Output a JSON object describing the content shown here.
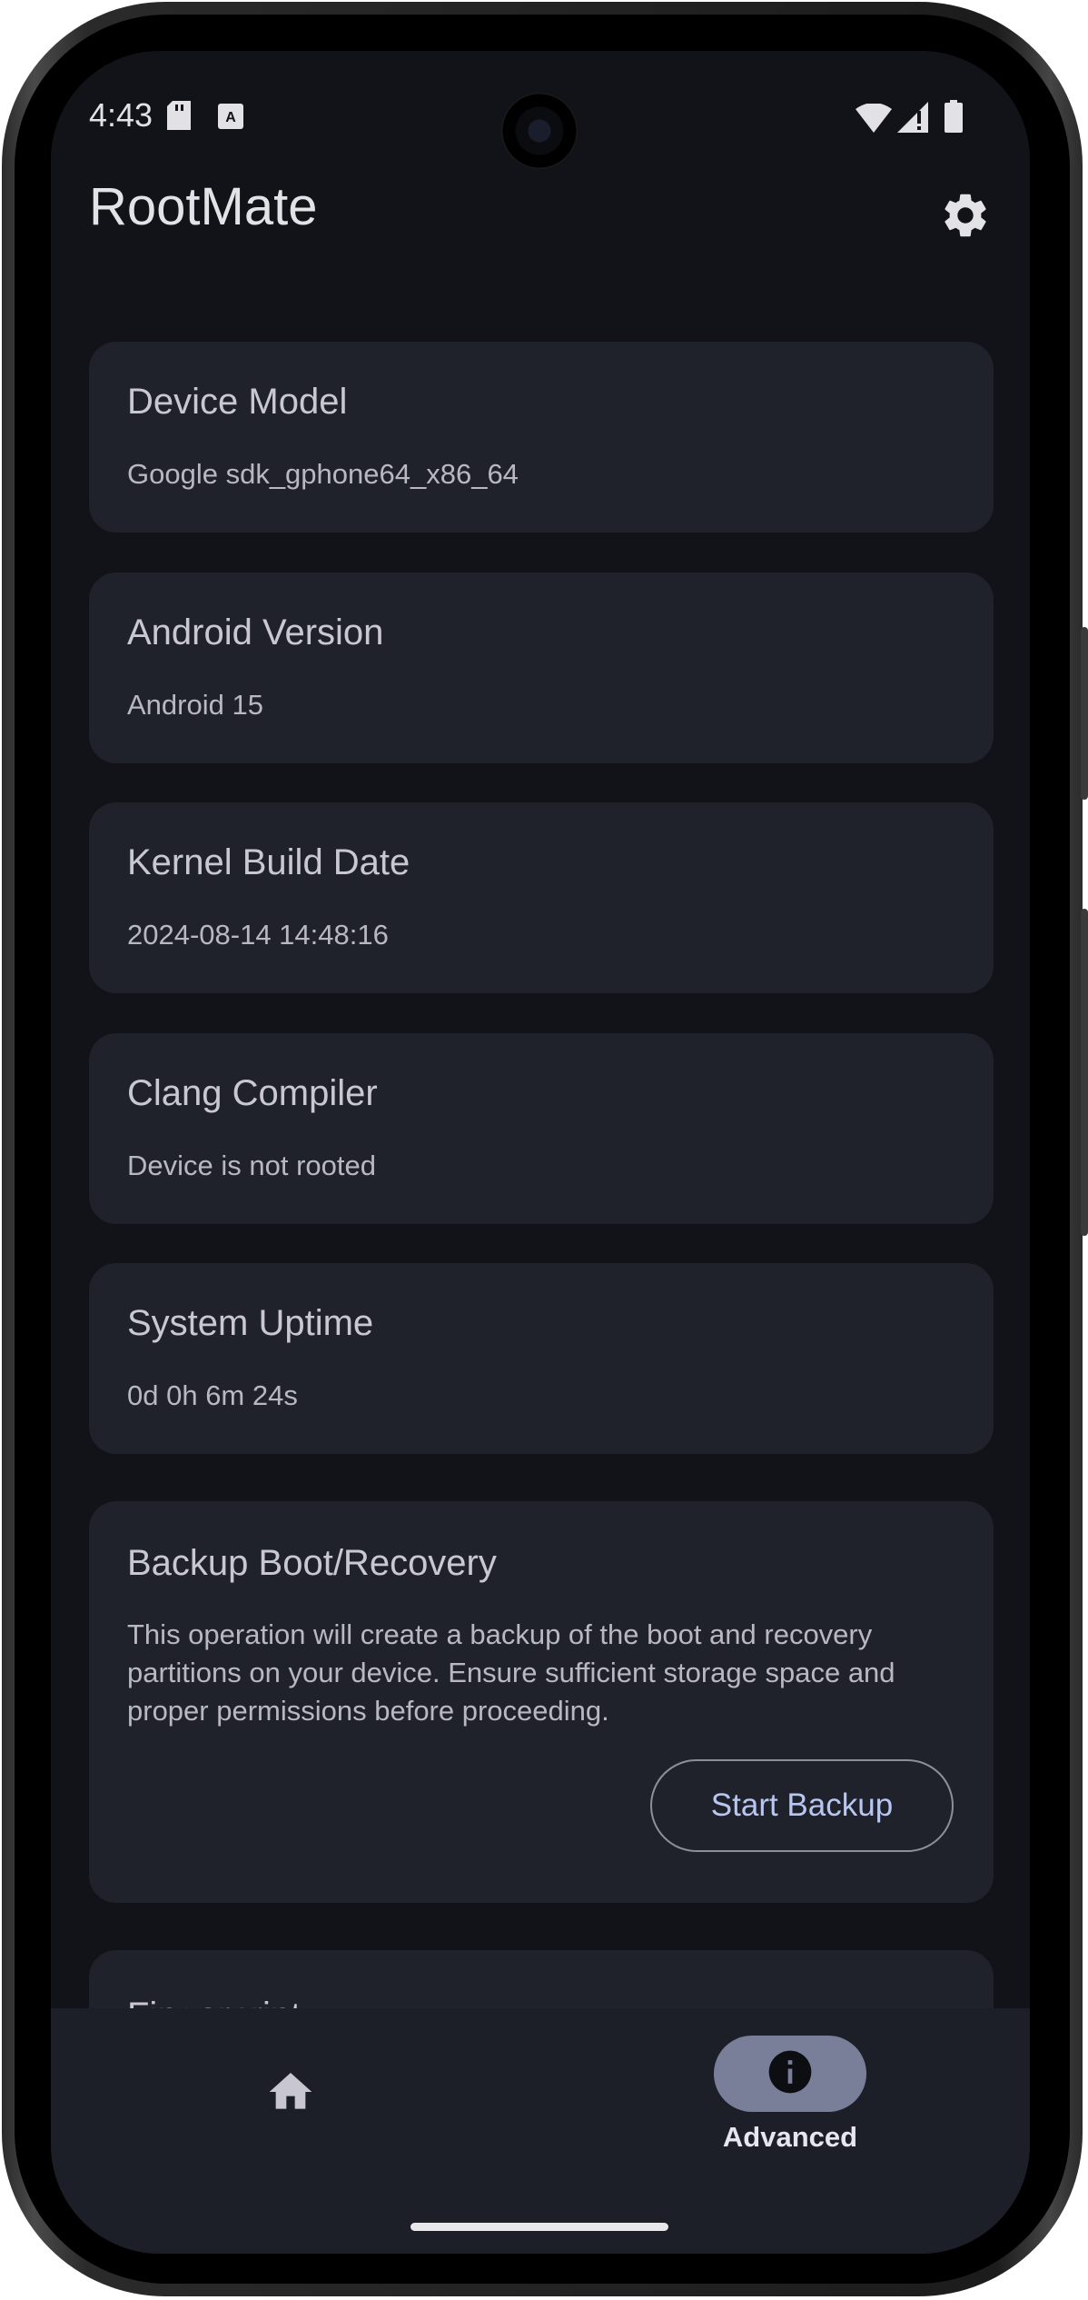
{
  "status_bar": {
    "time": "4:43"
  },
  "app_bar": {
    "title": "RootMate"
  },
  "cards": [
    {
      "title": "Device Model",
      "value": "Google sdk_gphone64_x86_64"
    },
    {
      "title": "Android Version",
      "value": "Android 15"
    },
    {
      "title": "Kernel Build Date",
      "value": "2024-08-14 14:48:16"
    },
    {
      "title": "Clang Compiler",
      "value": "Device is not rooted"
    },
    {
      "title": "System Uptime",
      "value": "0d 0h 6m 24s"
    }
  ],
  "backup_card": {
    "title": "Backup Boot/Recovery",
    "description": "This operation will create a backup of the boot and recovery partitions on your device. Ensure sufficient storage space and proper permissions before proceeding.",
    "button_label": "Start Backup"
  },
  "fingerprint_card": {
    "title": "Fingerprint"
  },
  "bottom_nav": {
    "items": [
      {
        "icon": "home-icon",
        "label": ""
      },
      {
        "icon": "info-icon",
        "label": "Advanced",
        "selected": true
      }
    ]
  },
  "colors": {
    "background": "#111318",
    "card": "#1f222b",
    "accent_text": "#b8c6f2",
    "nav_selected_pill": "#7a7f99"
  }
}
